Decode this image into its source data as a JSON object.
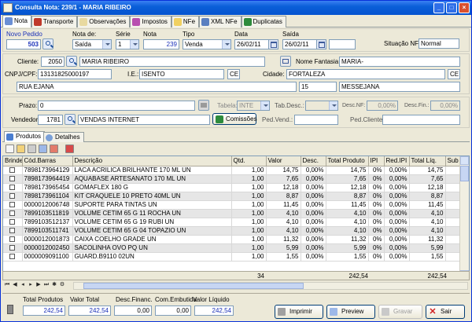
{
  "window": {
    "title": "Consulta Nota: 239/1  - MARIA RIBEIRO"
  },
  "tabs": [
    {
      "label": "Nota"
    },
    {
      "label": "Transporte"
    },
    {
      "label": "Observações"
    },
    {
      "label": "Impostos"
    },
    {
      "label": "NFe"
    },
    {
      "label": "XML NFe"
    },
    {
      "label": "Duplicatas"
    }
  ],
  "header": {
    "novo_pedido_label": "Novo Pedido",
    "novo_pedido_value": "503",
    "nota_de_label": "Nota de:",
    "nota_de_value": "Saída",
    "serie_label": "Série",
    "serie_value": "1",
    "nota_label": "Nota",
    "nota_value": "239",
    "tipo_label": "Tipo",
    "tipo_value": "Venda",
    "data_label": "Data",
    "data_value": "26/02/11",
    "saida_label": "Saída",
    "saida_value": "26/02/11",
    "situacao_label": "Situação NF",
    "situacao_value": "Normal"
  },
  "cliente": {
    "cliente_label": "Cliente:",
    "codigo": "2050",
    "nome": "MARIA RIBEIRO",
    "nome_fantasia_label": "Nome Fantasia:",
    "nome_fantasia": "MARIA-",
    "cnpj_label": "CNPJ/CPF:",
    "cnpj": "13131825000197",
    "ie_label": "I.E.:",
    "ie": "ISENTO",
    "uf": "CE",
    "cidade_label": "Cidade:",
    "cidade": "FORTALEZA",
    "uf2": "CE",
    "rua": "RUA EJANA",
    "numero": "15",
    "bairro": "MESSEJANA"
  },
  "venda": {
    "prazo_label": "Prazo:",
    "prazo": "0",
    "tabela_label": "Tabela:",
    "tabela": "INTE",
    "tab_desc_label": "Tab.Desc.:",
    "desc_nf_label": "Desc.NF:",
    "desc_nf": "0,00%",
    "desc_fin_label": "Desc.Fin.:",
    "desc_fin": "0,00%",
    "vendedor_label": "Vendedor:",
    "vendedor_cod": "1781",
    "vendedor_nome": "VENDAS INTERNET",
    "comissoes_label": "Comissões",
    "ped_vend_label": "Ped.Vend.:",
    "ped_cliente_label": "Ped.Cliente:"
  },
  "subtabs": [
    {
      "label": "Produtos"
    },
    {
      "label": "Detalhes"
    }
  ],
  "grid": {
    "columns": [
      "Brinde",
      "Cód.Barras",
      "Descrição",
      "Qtd.",
      "Valor",
      "Desc.",
      "Total Produto",
      "IPI",
      "Red.IPI",
      "Total Líq.",
      "Sub"
    ],
    "rows": [
      [
        "7898173964129",
        "LACA ACRILICA BRILHANTE 170 ML UN",
        "1,00",
        "14,75",
        "0,00%",
        "14,75",
        "0%",
        "0,00%",
        "14,75"
      ],
      [
        "7898173964419",
        "AQUABASE ARTESANATO 170 ML UN",
        "1,00",
        "7,65",
        "0,00%",
        "7,65",
        "0%",
        "0,00%",
        "7,65"
      ],
      [
        "7898173965454",
        "GOMAFLEX 180 G",
        "1,00",
        "12,18",
        "0,00%",
        "12,18",
        "0%",
        "0,00%",
        "12,18"
      ],
      [
        "7898173961104",
        "KIT CRAQUELE 10 PRETO 40ML UN",
        "1,00",
        "8,87",
        "0,00%",
        "8,87",
        "0%",
        "0,00%",
        "8,87"
      ],
      [
        "0000012006748",
        "SUPORTE PARA TINTAS UN",
        "1,00",
        "11,45",
        "0,00%",
        "11,45",
        "0%",
        "0,00%",
        "11,45"
      ],
      [
        "7899103511819",
        "VOLUME CETIM 65 G 11 ROCHA UN",
        "1,00",
        "4,10",
        "0,00%",
        "4,10",
        "0%",
        "0,00%",
        "4,10"
      ],
      [
        "7899103512137",
        "VOLUME CETIM 65 G 19 RUBI UN",
        "1,00",
        "4,10",
        "0,00%",
        "4,10",
        "0%",
        "0,00%",
        "4,10"
      ],
      [
        "7899103511741",
        "VOLUME CETIM 65 G 04 TOPAZIO UN",
        "1,00",
        "4,10",
        "0,00%",
        "4,10",
        "0%",
        "0,00%",
        "4,10"
      ],
      [
        "0000012001873",
        "CAIXA COELHO GRADE UN",
        "1,00",
        "11,32",
        "0,00%",
        "11,32",
        "0%",
        "0,00%",
        "11,32"
      ],
      [
        "0000012002450",
        "SACOLINHA OVO PQ UN",
        "1,00",
        "5,99",
        "0,00%",
        "5,99",
        "0%",
        "0,00%",
        "5,99"
      ],
      [
        "0000009091100",
        "GUARD.B9110 02UN",
        "1,00",
        "1,55",
        "0,00%",
        "1,55",
        "0%",
        "0,00%",
        "1,55"
      ]
    ],
    "totals": {
      "qtd": "34",
      "total_produto": "242,54",
      "total_liq": "242,54"
    }
  },
  "footer": {
    "total_produtos_label": "Total Produtos",
    "total_produtos": "242,54",
    "valor_total_label": "Valor Total",
    "valor_total": "242,54",
    "desc_financ_label": "Desc.Financ.",
    "desc_financ": "0,00",
    "com_embutida_label": "Com.Embutida",
    "com_embutida": "0,00",
    "valor_liquido_label": "Valor Líquido",
    "valor_liquido": "242,54",
    "imprimir_label": "Imprimir",
    "preview_label": "Preview",
    "gravar_label": "Gravar",
    "sair_label": "Sair"
  },
  "colors": {
    "title_blue": "#0a5fd8",
    "value_blue": "#1a30b8",
    "accent": "#0831d9"
  }
}
